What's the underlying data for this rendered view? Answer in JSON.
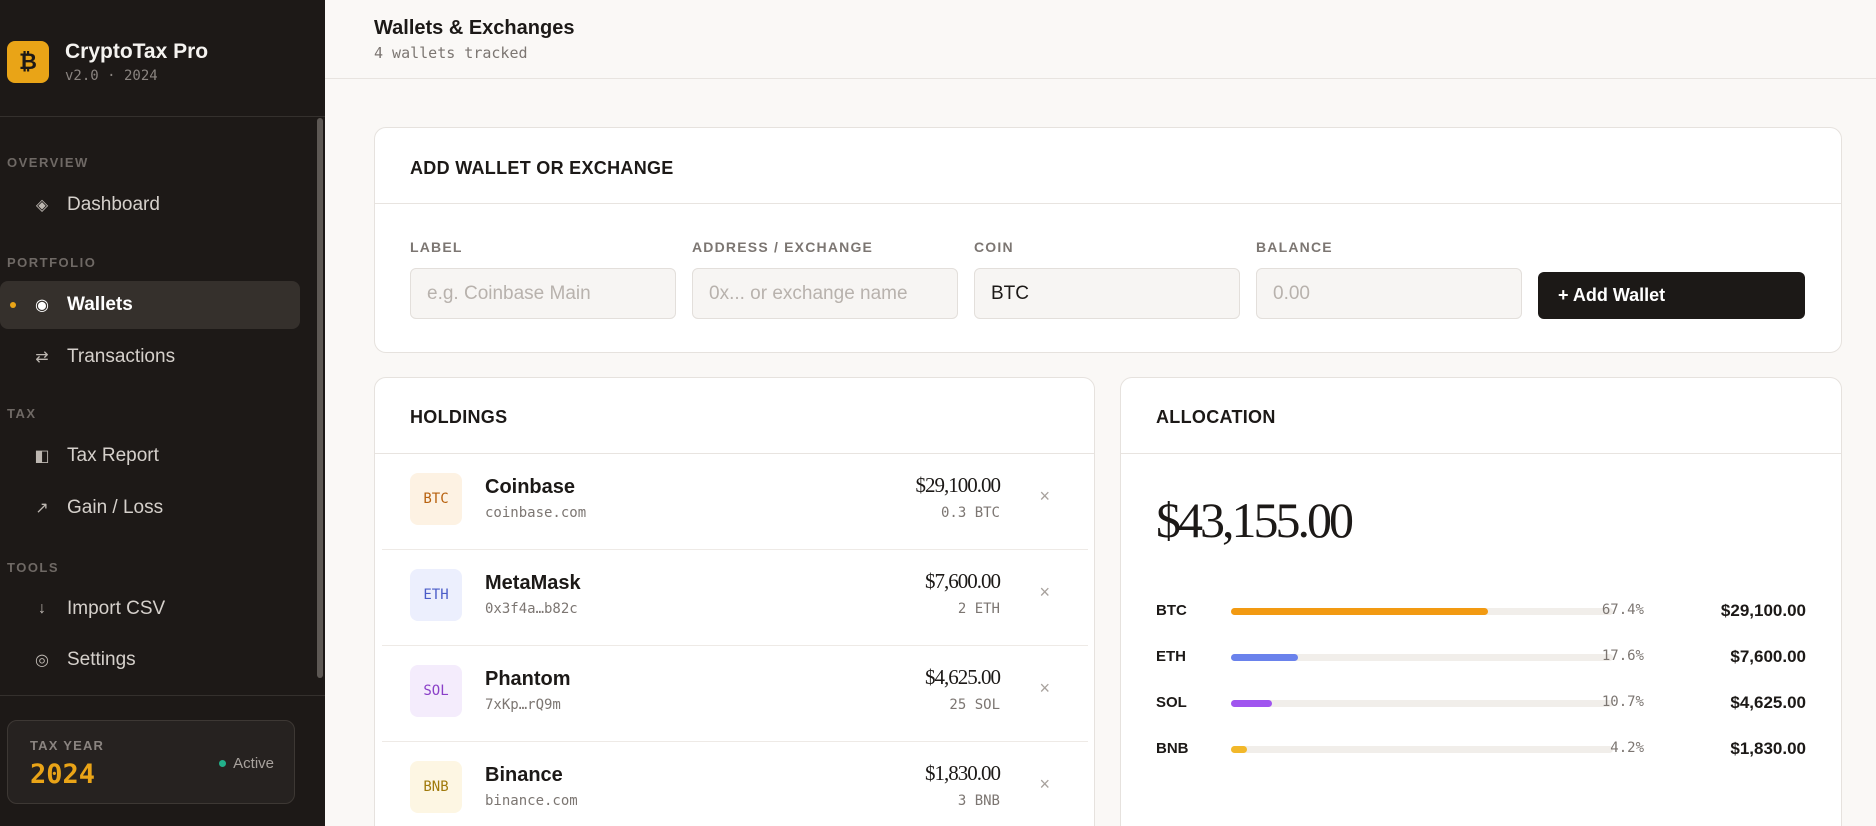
{
  "brand": {
    "logo_glyph": "₿",
    "name": "CryptoTax Pro",
    "version": "v2.0 · 2024",
    "accent": "#e9a417"
  },
  "sidebar": {
    "sections": {
      "overview": "OVERVIEW",
      "portfolio": "PORTFOLIO",
      "tax": "TAX",
      "tools": "TOOLS"
    },
    "items": [
      {
        "label": "Dashboard",
        "icon": "diamond-icon",
        "glyph": "◈",
        "active": false
      },
      {
        "label": "Wallets",
        "icon": "target-icon",
        "glyph": "◉",
        "active": true
      },
      {
        "label": "Transactions",
        "icon": "swap-arrows-icon",
        "glyph": "⇄",
        "active": false
      },
      {
        "label": "Tax Report",
        "icon": "half-square-icon",
        "glyph": "◧",
        "active": false
      },
      {
        "label": "Gain / Loss",
        "icon": "trend-arrow-icon",
        "glyph": "↗",
        "active": false
      },
      {
        "label": "Import CSV",
        "icon": "download-arrow-icon",
        "glyph": "↓",
        "active": false
      },
      {
        "label": "Settings",
        "icon": "gear-icon",
        "glyph": "◎",
        "active": false
      }
    ],
    "tax_year": {
      "label": "TAX YEAR",
      "year": "2024",
      "status": "Active"
    }
  },
  "header": {
    "title": "Wallets & Exchanges",
    "subtitle": "4 wallets tracked"
  },
  "add_wallet": {
    "title": "ADD WALLET OR EXCHANGE",
    "label_field": {
      "label": "LABEL",
      "placeholder": "e.g. Coinbase Main",
      "value": ""
    },
    "address_field": {
      "label": "ADDRESS / EXCHANGE",
      "placeholder": "0x... or exchange name",
      "value": ""
    },
    "coin_field": {
      "label": "COIN",
      "value": "BTC"
    },
    "balance_field": {
      "label": "BALANCE",
      "placeholder": "0.00",
      "value": ""
    },
    "button": "+ Add Wallet"
  },
  "holdings": {
    "title": "HOLDINGS",
    "remove_glyph": "×",
    "items": [
      {
        "coin": "BTC",
        "name": "Coinbase",
        "address": "coinbase.com",
        "value": "$29,100.00",
        "amount": "0.3 BTC",
        "badge_bg": "#fdf2e3",
        "badge_color": "#b8620f"
      },
      {
        "coin": "ETH",
        "name": "MetaMask",
        "address": "0x3f4a…b82c",
        "value": "$7,600.00",
        "amount": "2 ETH",
        "badge_bg": "#eceffd",
        "badge_color": "#4a5cc8"
      },
      {
        "coin": "SOL",
        "name": "Phantom",
        "address": "7xKp…rQ9m",
        "value": "$4,625.00",
        "amount": "25 SOL",
        "badge_bg": "#f4ecfc",
        "badge_color": "#8a3fc8"
      },
      {
        "coin": "BNB",
        "name": "Binance",
        "address": "binance.com",
        "value": "$1,830.00",
        "amount": "3 BNB",
        "badge_bg": "#fdf6e3",
        "badge_color": "#a07a0c"
      }
    ]
  },
  "allocation": {
    "title": "ALLOCATION",
    "total": "$43,155.00",
    "rows": [
      {
        "coin": "BTC",
        "fraction": 0.674,
        "pct": "67.4%",
        "value": "$29,100.00",
        "color": "#f29a12"
      },
      {
        "coin": "ETH",
        "fraction": 0.176,
        "pct": "17.6%",
        "value": "$7,600.00",
        "color": "#6a82ec"
      },
      {
        "coin": "SOL",
        "fraction": 0.107,
        "pct": "10.7%",
        "value": "$4,625.00",
        "color": "#a055ef"
      },
      {
        "coin": "BNB",
        "fraction": 0.042,
        "pct": "4.2%",
        "value": "$1,830.00",
        "color": "#f2b82a"
      }
    ]
  }
}
